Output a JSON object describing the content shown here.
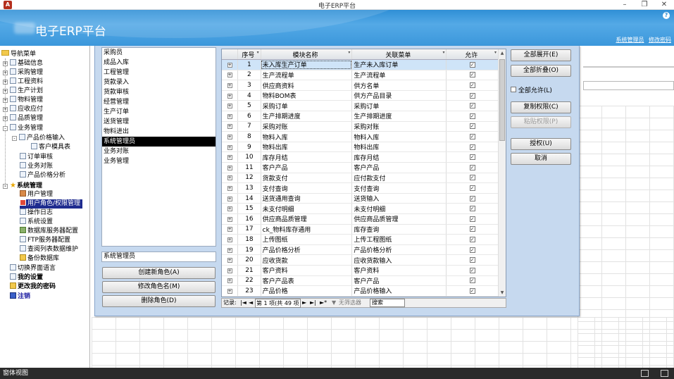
{
  "window": {
    "title": "电子ERP平台",
    "app_icon": "A"
  },
  "header": {
    "title": "电子ERP平台",
    "help": "?",
    "links": [
      "系统管理员",
      "修改密码"
    ]
  },
  "nav": {
    "root": "导航菜单",
    "items": [
      {
        "label": "基础信息",
        "level": 1,
        "expander": "+"
      },
      {
        "label": "采购管理",
        "level": 1,
        "expander": "+"
      },
      {
        "label": "工程资料",
        "level": 1,
        "expander": "+"
      },
      {
        "label": "生产计划",
        "level": 1,
        "expander": "+"
      },
      {
        "label": "物料管理",
        "level": 1,
        "expander": "+"
      },
      {
        "label": "应收应付",
        "level": 1,
        "expander": "+"
      },
      {
        "label": "品质管理",
        "level": 1,
        "expander": "+"
      },
      {
        "label": "业务管理",
        "level": 1,
        "expander": "-"
      },
      {
        "label": "产品价格输入",
        "level": 2,
        "expander": "-"
      },
      {
        "label": "客户模具表",
        "level": 3
      },
      {
        "label": "订单审核",
        "level": 2
      },
      {
        "label": "业务对账",
        "level": 2
      },
      {
        "label": "产品价格分析",
        "level": 2
      },
      {
        "label": "系统管理",
        "level": 1,
        "expander": "-",
        "bold": true
      },
      {
        "label": "用户管理",
        "level": 2
      },
      {
        "label": "用户角色/权限管理",
        "level": 2,
        "selected": true
      },
      {
        "label": "操作日志",
        "level": 2
      },
      {
        "label": "系统设置",
        "level": 2
      },
      {
        "label": "数据库服务器配置",
        "level": 2
      },
      {
        "label": "FTP服务器配置",
        "level": 2
      },
      {
        "label": "查阅列表数据维护",
        "level": 2
      },
      {
        "label": "备份数据库",
        "level": 2
      },
      {
        "label": "切换界面语言",
        "level": 1
      },
      {
        "label": "我的设置",
        "level": 1,
        "bold": true
      },
      {
        "label": "更改我的密码",
        "level": 1,
        "bold": true
      },
      {
        "label": "注销",
        "level": 1,
        "blue": true
      }
    ]
  },
  "roles": {
    "items": [
      "采购员",
      "成品入库",
      "工程管理",
      "货款录入",
      "货款审核",
      "经营管理",
      "生产订单",
      "送货管理",
      "物料进出",
      "系统管理员",
      "业务对账",
      "业务管理"
    ],
    "selected_index": 9,
    "name_value": "系统管理员",
    "create_label": "创建新角色(A)",
    "rename_label": "修改角色名(M)",
    "delete_label": "删除角色(D)"
  },
  "table": {
    "columns": [
      "序号",
      "模块名称",
      "关联菜单",
      "允许"
    ],
    "rows": [
      {
        "no": "1",
        "module": "未入库生产订单",
        "menu": "生产未入库订单",
        "allowed": true
      },
      {
        "no": "2",
        "module": "生产流程单",
        "menu": "生产流程单",
        "allowed": true
      },
      {
        "no": "3",
        "module": "供应商资料",
        "menu": "供方名单",
        "allowed": true
      },
      {
        "no": "4",
        "module": "物料BOM表",
        "menu": "供方产品目录",
        "allowed": true
      },
      {
        "no": "5",
        "module": "采购订单",
        "menu": "采购订单",
        "allowed": true
      },
      {
        "no": "6",
        "module": "生产排期进度",
        "menu": "生产排期进度",
        "allowed": true
      },
      {
        "no": "7",
        "module": "采购对账",
        "menu": "采购对账",
        "allowed": true
      },
      {
        "no": "8",
        "module": "物料入库",
        "menu": "物料入库",
        "allowed": true
      },
      {
        "no": "9",
        "module": "物料出库",
        "menu": "物料出库",
        "allowed": true
      },
      {
        "no": "10",
        "module": "库存月结",
        "menu": "库存月结",
        "allowed": true
      },
      {
        "no": "11",
        "module": "客户产品",
        "menu": "客户产品",
        "allowed": true
      },
      {
        "no": "12",
        "module": "货款支付",
        "menu": "应付款支付",
        "allowed": true
      },
      {
        "no": "13",
        "module": "支付查询",
        "menu": "支付查询",
        "allowed": true
      },
      {
        "no": "14",
        "module": "送货通用查询",
        "menu": "送货输入",
        "allowed": true
      },
      {
        "no": "15",
        "module": "未支付明细",
        "menu": "未支付明细",
        "allowed": true
      },
      {
        "no": "16",
        "module": "供应商品质管理",
        "menu": "供应商品质管理",
        "allowed": true
      },
      {
        "no": "17",
        "module": "ck_物料库存通用",
        "menu": "库存查询",
        "allowed": true
      },
      {
        "no": "18",
        "module": "上传图纸",
        "menu": "上传工程图纸",
        "allowed": true
      },
      {
        "no": "19",
        "module": "产品价格分析",
        "menu": "产品价格分析",
        "allowed": true
      },
      {
        "no": "20",
        "module": "应收货款",
        "menu": "应收货款输入",
        "allowed": true
      },
      {
        "no": "21",
        "module": "客户资料",
        "menu": "客户资料",
        "allowed": true
      },
      {
        "no": "22",
        "module": "客户产品表",
        "menu": "客户产品",
        "allowed": true
      },
      {
        "no": "23",
        "module": "产品价格",
        "menu": "产品价格输入",
        "allowed": true
      }
    ],
    "highlighted_index": 0
  },
  "record_nav": {
    "label": "记录:",
    "first": "|◄",
    "prev": "◄",
    "position": "第 1 项(共 49 项",
    "next": "►",
    "last": "►|",
    "new": "►*",
    "filter": "无筛选器",
    "search": "搜索"
  },
  "actions": {
    "expand_all": "全部展开(E)",
    "collapse_all": "全部折叠(O)",
    "allow_all": "全部允许(L)",
    "copy": "复制权限(C)",
    "paste": "粘贴权限(P)",
    "grant": "授权(U)",
    "cancel": "取消"
  },
  "status": {
    "text": "窗体视图"
  }
}
